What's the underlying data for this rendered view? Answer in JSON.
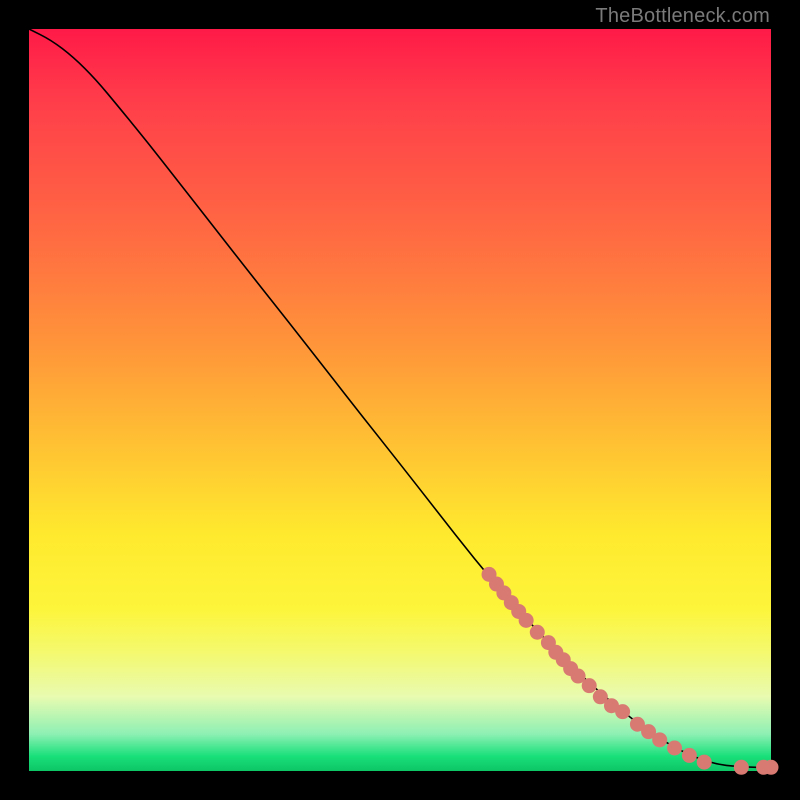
{
  "attribution": "TheBottleneck.com",
  "colors": {
    "curve": "#000000",
    "marker": "#d87a72",
    "marker_stroke": "#d87a72"
  },
  "chart_data": {
    "type": "line",
    "title": "",
    "xlabel": "",
    "ylabel": "",
    "xlim": [
      0,
      100
    ],
    "ylim": [
      0,
      100
    ],
    "curve": [
      {
        "x": 0,
        "y": 100
      },
      {
        "x": 3,
        "y": 98.5
      },
      {
        "x": 6,
        "y": 96.2
      },
      {
        "x": 9,
        "y": 93.2
      },
      {
        "x": 12,
        "y": 89.6
      },
      {
        "x": 16,
        "y": 84.7
      },
      {
        "x": 20,
        "y": 79.6
      },
      {
        "x": 25,
        "y": 73.2
      },
      {
        "x": 30,
        "y": 66.8
      },
      {
        "x": 35,
        "y": 60.5
      },
      {
        "x": 40,
        "y": 54.1
      },
      {
        "x": 45,
        "y": 47.7
      },
      {
        "x": 50,
        "y": 41.4
      },
      {
        "x": 55,
        "y": 35.0
      },
      {
        "x": 60,
        "y": 28.6
      },
      {
        "x": 65,
        "y": 22.7
      },
      {
        "x": 70,
        "y": 17.3
      },
      {
        "x": 75,
        "y": 12.3
      },
      {
        "x": 80,
        "y": 8.0
      },
      {
        "x": 84,
        "y": 5.0
      },
      {
        "x": 88,
        "y": 2.6
      },
      {
        "x": 92,
        "y": 1.0
      },
      {
        "x": 96,
        "y": 0.5
      },
      {
        "x": 100,
        "y": 0.5
      }
    ],
    "markers": [
      {
        "x": 62,
        "y": 26.5,
        "r": 1.0
      },
      {
        "x": 63,
        "y": 25.2,
        "r": 1.0
      },
      {
        "x": 64,
        "y": 24.0,
        "r": 1.0
      },
      {
        "x": 65,
        "y": 22.7,
        "r": 1.0
      },
      {
        "x": 66,
        "y": 21.5,
        "r": 1.0
      },
      {
        "x": 67,
        "y": 20.3,
        "r": 1.0
      },
      {
        "x": 68.5,
        "y": 18.7,
        "r": 1.0
      },
      {
        "x": 70,
        "y": 17.3,
        "r": 1.0
      },
      {
        "x": 71,
        "y": 16.0,
        "r": 1.0
      },
      {
        "x": 72,
        "y": 15.0,
        "r": 1.0
      },
      {
        "x": 73,
        "y": 13.8,
        "r": 1.0
      },
      {
        "x": 74,
        "y": 12.8,
        "r": 1.0
      },
      {
        "x": 75.5,
        "y": 11.5,
        "r": 1.0
      },
      {
        "x": 77,
        "y": 10.0,
        "r": 1.0
      },
      {
        "x": 78.5,
        "y": 8.8,
        "r": 1.0
      },
      {
        "x": 80,
        "y": 8.0,
        "r": 1.0
      },
      {
        "x": 82,
        "y": 6.3,
        "r": 1.0
      },
      {
        "x": 83.5,
        "y": 5.3,
        "r": 1.0
      },
      {
        "x": 85,
        "y": 4.2,
        "r": 1.0
      },
      {
        "x": 87,
        "y": 3.1,
        "r": 1.0
      },
      {
        "x": 89,
        "y": 2.1,
        "r": 1.0
      },
      {
        "x": 91,
        "y": 1.2,
        "r": 1.0
      },
      {
        "x": 96,
        "y": 0.5,
        "r": 1.0
      },
      {
        "x": 99,
        "y": 0.5,
        "r": 1.0
      },
      {
        "x": 100,
        "y": 0.5,
        "r": 1.0
      }
    ]
  }
}
